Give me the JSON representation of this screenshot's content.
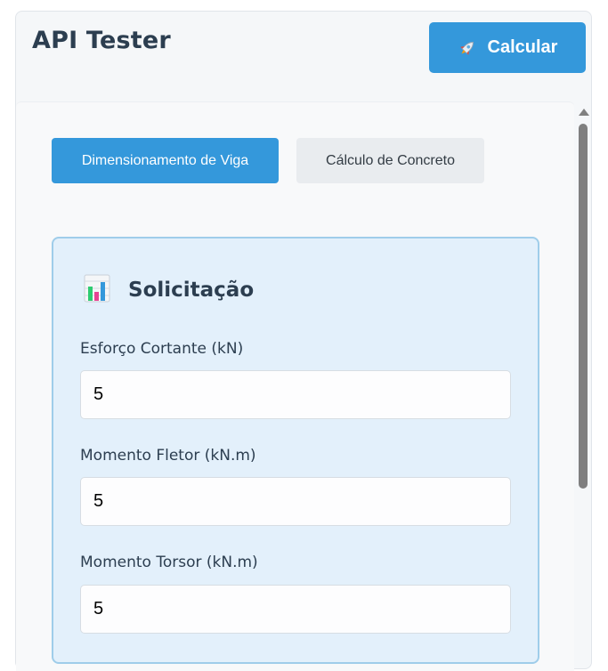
{
  "app": {
    "title": "API Tester"
  },
  "toolbar": {
    "calculate_label": "Calcular",
    "calculate_icon": "rocket-icon"
  },
  "tabs": [
    {
      "label": "Dimensionamento de Viga",
      "active": true
    },
    {
      "label": "Cálculo de Concreto",
      "active": false
    }
  ],
  "card": {
    "icon": "bar-chart-icon",
    "title": "Solicitação",
    "fields": [
      {
        "label": "Esforço Cortante (kN)",
        "value": "5"
      },
      {
        "label": "Momento Fletor (kN.m)",
        "value": "5"
      },
      {
        "label": "Momento Torsor (kN.m)",
        "value": "5"
      }
    ]
  },
  "colors": {
    "accent": "#3498db",
    "card_background": "#e3f0fb",
    "card_border": "#9fcdea",
    "title_text": "#2c3e50"
  }
}
